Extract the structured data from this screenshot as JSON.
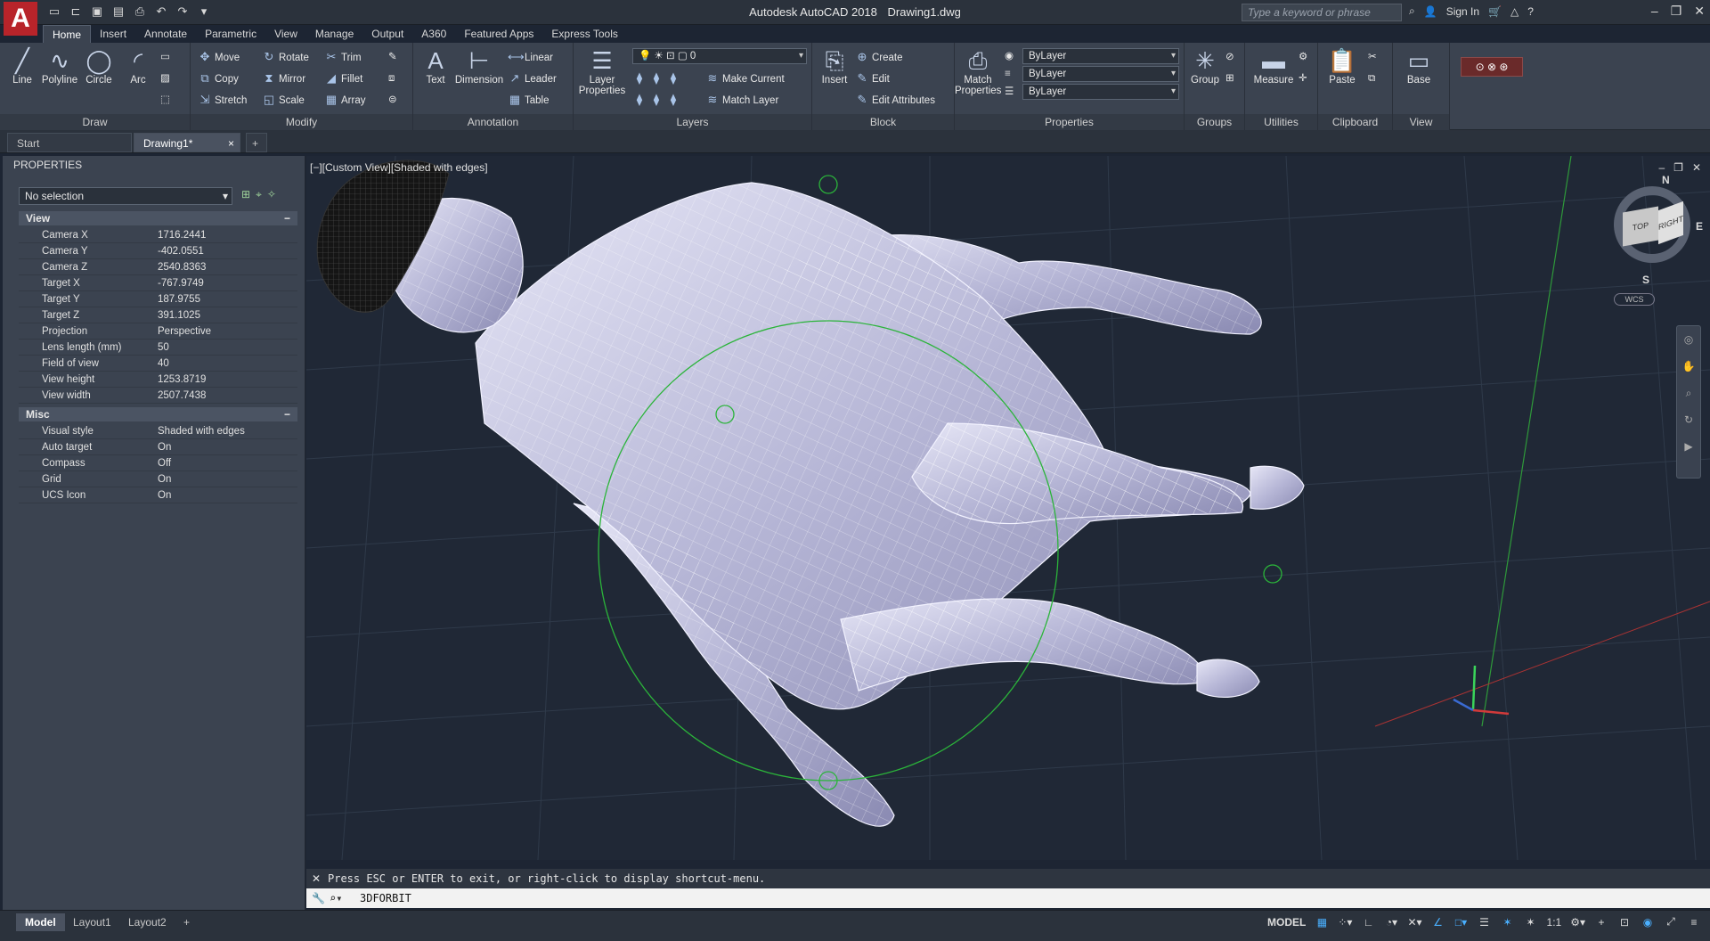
{
  "app": {
    "logo_letter": "A",
    "title_product": "Autodesk AutoCAD 2018",
    "title_file": "Drawing1.dwg",
    "search_placeholder": "Type a keyword or phrase",
    "sign_in": "Sign In"
  },
  "ribbon_tabs": [
    "Home",
    "Insert",
    "Annotate",
    "Parametric",
    "View",
    "Manage",
    "Output",
    "A360",
    "Featured Apps",
    "Express Tools"
  ],
  "ribbon": {
    "draw": {
      "title": "Draw",
      "line": "Line",
      "polyline": "Polyline",
      "circle": "Circle",
      "arc": "Arc"
    },
    "modify": {
      "title": "Modify",
      "move": "Move",
      "rotate": "Rotate",
      "trim": "Trim",
      "copy": "Copy",
      "mirror": "Mirror",
      "fillet": "Fillet",
      "stretch": "Stretch",
      "scale": "Scale",
      "array": "Array"
    },
    "annotation": {
      "title": "Annotation",
      "text": "Text",
      "dimension": "Dimension",
      "linear": "Linear",
      "leader": "Leader",
      "table": "Table"
    },
    "layers": {
      "title": "Layers",
      "layer_properties": "Layer Properties",
      "current_layer": "0",
      "make_current": "Make Current",
      "match_layer": "Match Layer"
    },
    "block": {
      "title": "Block",
      "insert": "Insert",
      "create": "Create",
      "edit": "Edit",
      "edit_attributes": "Edit Attributes"
    },
    "properties": {
      "title": "Properties",
      "match_properties": "Match Properties",
      "color": "ByLayer",
      "linetype": "ByLayer",
      "lineweight": "ByLayer"
    },
    "groups": {
      "title": "Groups",
      "group": "Group"
    },
    "utilities": {
      "title": "Utilities",
      "measure": "Measure"
    },
    "clipboard": {
      "title": "Clipboard",
      "paste": "Paste"
    },
    "view": {
      "title": "View",
      "base": "Base"
    }
  },
  "doc_tabs": {
    "start": "Start",
    "drawing": "Drawing1*"
  },
  "properties_palette": {
    "title": "PROPERTIES",
    "selection": "No selection",
    "view_section": "View",
    "view_rows": [
      {
        "k": "Camera X",
        "v": "1716.2441"
      },
      {
        "k": "Camera Y",
        "v": "-402.0551"
      },
      {
        "k": "Camera Z",
        "v": "2540.8363"
      },
      {
        "k": "Target X",
        "v": "-767.9749"
      },
      {
        "k": "Target Y",
        "v": "187.9755"
      },
      {
        "k": "Target Z",
        "v": "391.1025"
      },
      {
        "k": "Projection",
        "v": "Perspective"
      },
      {
        "k": "Lens length (mm)",
        "v": "50"
      },
      {
        "k": "Field of view",
        "v": "40"
      },
      {
        "k": "View height",
        "v": "1253.8719"
      },
      {
        "k": "View width",
        "v": "2507.7438"
      }
    ],
    "misc_section": "Misc",
    "misc_rows": [
      {
        "k": "Visual style",
        "v": "Shaded with edges"
      },
      {
        "k": "Auto target",
        "v": "On"
      },
      {
        "k": "Compass",
        "v": "Off"
      },
      {
        "k": "Grid",
        "v": "On"
      },
      {
        "k": "UCS Icon",
        "v": "On"
      }
    ]
  },
  "viewport": {
    "label": "[−][Custom View][Shaded with edges]",
    "viewcube_top": "TOP",
    "viewcube_right": "RIGHT",
    "compass_n": "N",
    "compass_e": "E",
    "compass_s": "S",
    "wcs": "WCS"
  },
  "command": {
    "history": "Press ESC or ENTER to exit, or right-click to display shortcut-menu.",
    "input": "3DFORBIT"
  },
  "layout_tabs": [
    "Model",
    "Layout1",
    "Layout2"
  ],
  "status": {
    "model": "MODEL",
    "scale": "1:1"
  }
}
